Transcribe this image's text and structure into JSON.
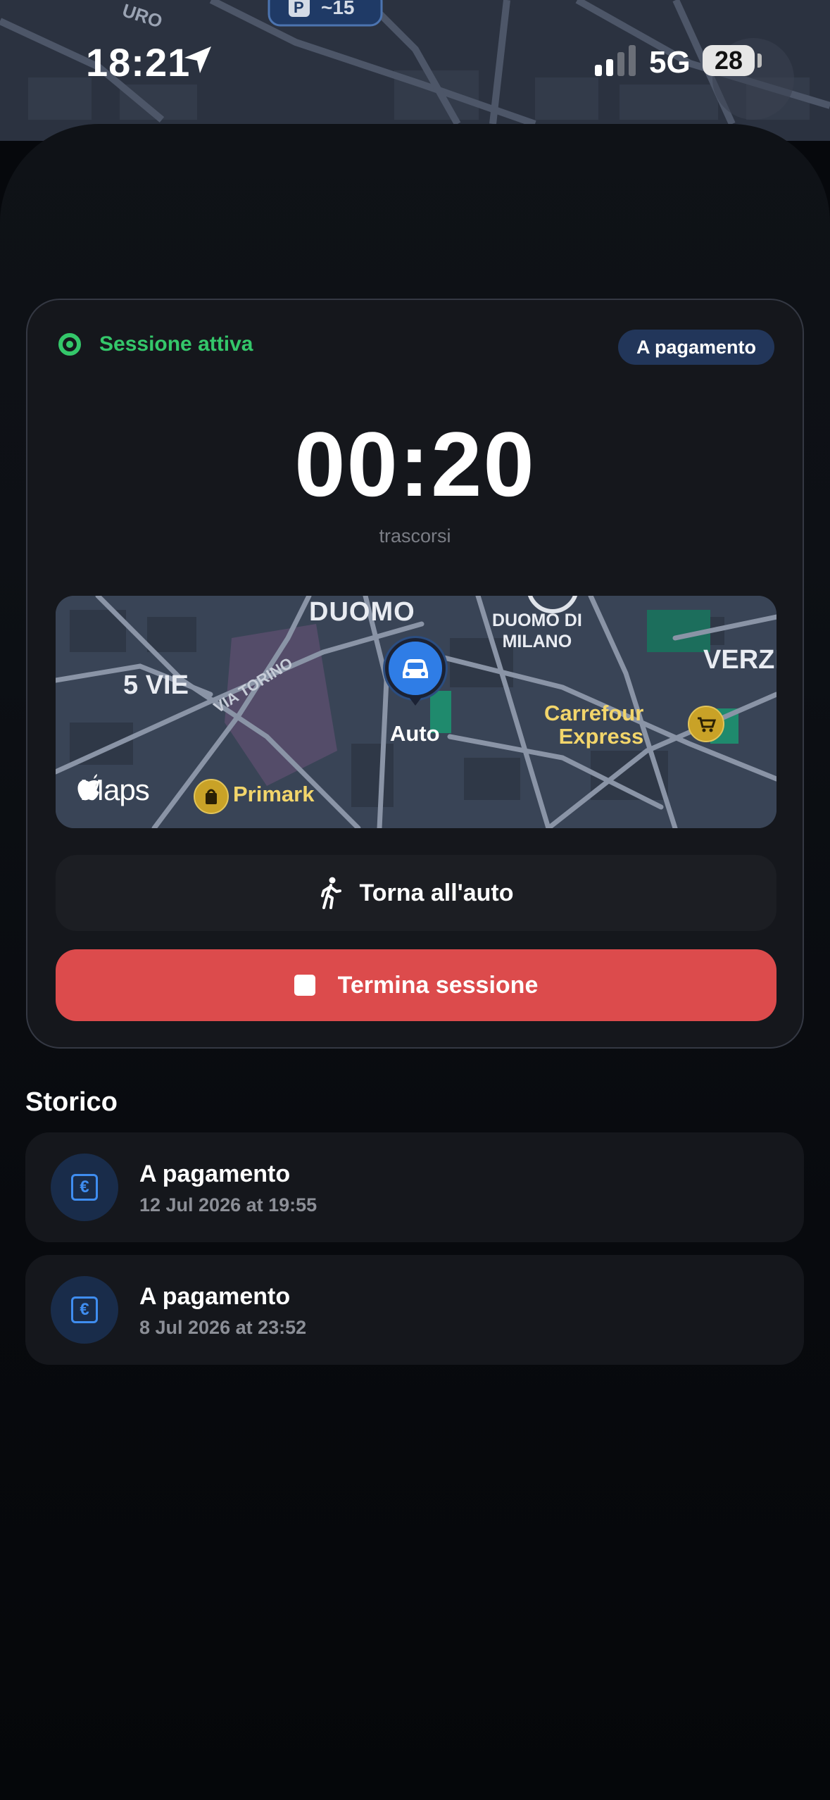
{
  "status_bar": {
    "time": "18:21",
    "network": "5G",
    "battery": "28",
    "location_icon": "location-arrow-icon",
    "signal_icon": "cellular-signal-icon"
  },
  "background_map": {
    "labels": [
      "URO",
      "P",
      "~15"
    ]
  },
  "session": {
    "status_label": "Sessione attiva",
    "type_badge": "A pagamento",
    "elapsed": "00:20",
    "elapsed_caption": "trascorsi",
    "map": {
      "labels": {
        "duomo": "DUOMO",
        "duomo_di_milano_line1": "DUOMO DI",
        "duomo_di_milano_line2": "MILANO",
        "verziere": "VERZI",
        "cinque_vie": "5 VIE",
        "via_torino": "VIA TORINO",
        "carrefour_line1": "Carrefour",
        "carrefour_line2": "Express",
        "primark": "Primark",
        "car_pin": "Auto",
        "maps_brand": "Maps"
      }
    },
    "back_button_label": "Torna all'auto",
    "end_button_label": "Termina sessione"
  },
  "history": {
    "title": "Storico",
    "items": [
      {
        "name": "A pagamento",
        "date": "12 Jul 2026 at 19:55"
      },
      {
        "name": "A pagamento",
        "date": "8 Jul 2026 at 23:52"
      }
    ]
  },
  "colors": {
    "active_green": "#34c76a",
    "badge_blue": "#22365a",
    "end_red": "#dc4b4c",
    "euro_blue": "#3f8df0"
  }
}
